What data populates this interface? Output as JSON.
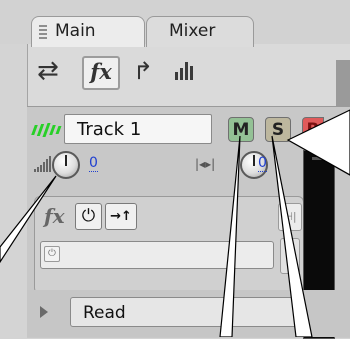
{
  "tabs": [
    {
      "label": "Main",
      "active": true
    },
    {
      "label": "Mixer",
      "active": false
    }
  ],
  "toolbar": {
    "icons": [
      "swap-arrows-icon",
      "fx-icon",
      "routing-icon",
      "meter-icon"
    ],
    "fx_label": "fx"
  },
  "track": {
    "name": "Track 1",
    "buttons": {
      "mute": "M",
      "solo": "S",
      "record": "R"
    },
    "volume_value": "0",
    "pan_value": "0"
  },
  "effects": {
    "fx_label": "fx",
    "power_glyph": "⏻",
    "insert_glyph": "→↑"
  },
  "automation": {
    "mode": "Read"
  },
  "colors": {
    "vu_green": "#28d028",
    "mute_button": "#93c195",
    "solo_button": "#bdb79e",
    "record_button": "#e05a5a",
    "value_blue": "#2040d0"
  }
}
